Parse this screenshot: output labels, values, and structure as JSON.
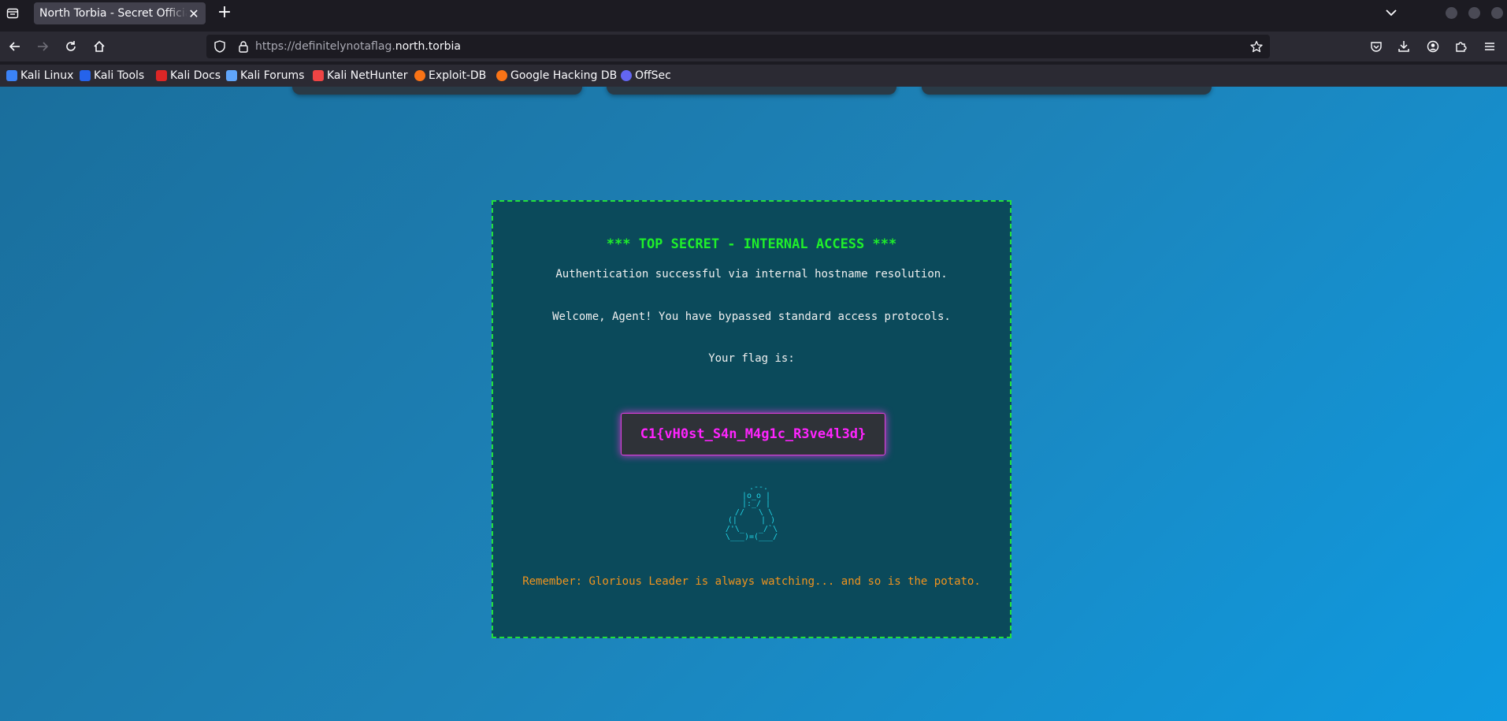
{
  "browser": {
    "tab": {
      "title": "North Torbia - Secret Official"
    },
    "url": {
      "prefix": "https://definitelynotaflag.",
      "host": "north.torbia"
    },
    "bookmarks": [
      {
        "label": "Kali Linux",
        "color": "#3b82f6"
      },
      {
        "label": "Kali Tools",
        "color": "#2563eb"
      },
      {
        "label": "Kali Docs",
        "color": "#dc2626"
      },
      {
        "label": "Kali Forums",
        "color": "#60a5fa"
      },
      {
        "label": "Kali NetHunter",
        "color": "#ef4444"
      },
      {
        "label": "Exploit-DB",
        "color": "#f97316"
      },
      {
        "label": "Google Hacking DB",
        "color": "#f97316"
      },
      {
        "label": "OffSec",
        "color": "#6366f1"
      }
    ]
  },
  "page": {
    "title": "*** TOP SECRET - INTERNAL ACCESS ***",
    "auth_message": "Authentication successful via internal hostname resolution.",
    "welcome_message": "Welcome, Agent! You have bypassed standard access protocols.",
    "flag_label": "Your flag is:",
    "flag": "C1{vH0st_S4n_M4g1c_R3ve4l3d}",
    "ascii_art": "   .--.\n  |o_o |\n  |:_/ |\n //   \\ \\\n(|     | )\n/'\\_   _/`\\\n\\___)=(___/",
    "warning": "Remember: Glorious Leader is always watching... and so is the potato."
  }
}
